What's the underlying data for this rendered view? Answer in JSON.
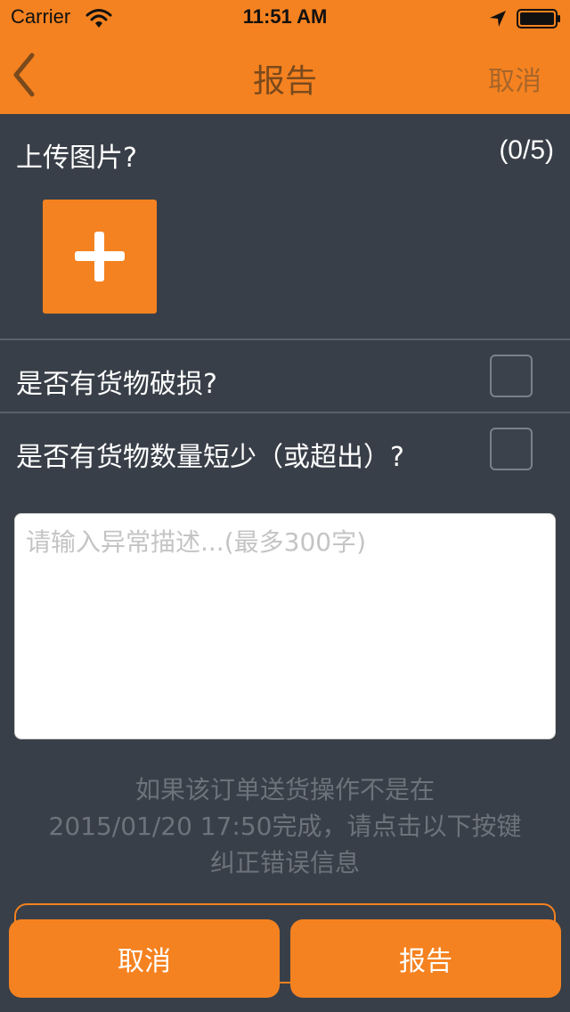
{
  "status_bar": {
    "carrier": "Carrier",
    "time": "11:51 AM"
  },
  "nav": {
    "title": "报告",
    "cancel_label": "取消"
  },
  "upload": {
    "label": "上传图片?",
    "count": "(0/5)"
  },
  "questions": [
    {
      "label": "是否有货物破损?",
      "checked": false
    },
    {
      "label": "是否有货物数量短少（或超出）?",
      "checked": false
    }
  ],
  "description": {
    "value": "",
    "placeholder": "请输入异常描述...(最多300字)"
  },
  "notice": {
    "line1": "如果该订单送货操作不是在",
    "line2": "2015/01/20  17:50完成，请点击以下按键",
    "line3": "纠正错误信息"
  },
  "bottom_actions": {
    "cancel_label": "取消",
    "report_label": "报告"
  },
  "colors": {
    "accent": "#f58220",
    "background": "#393f48"
  },
  "icons": {
    "back": "chevron-left-icon",
    "add": "plus-icon",
    "wifi": "wifi-icon",
    "location": "location-arrow-icon",
    "battery": "battery-icon"
  }
}
